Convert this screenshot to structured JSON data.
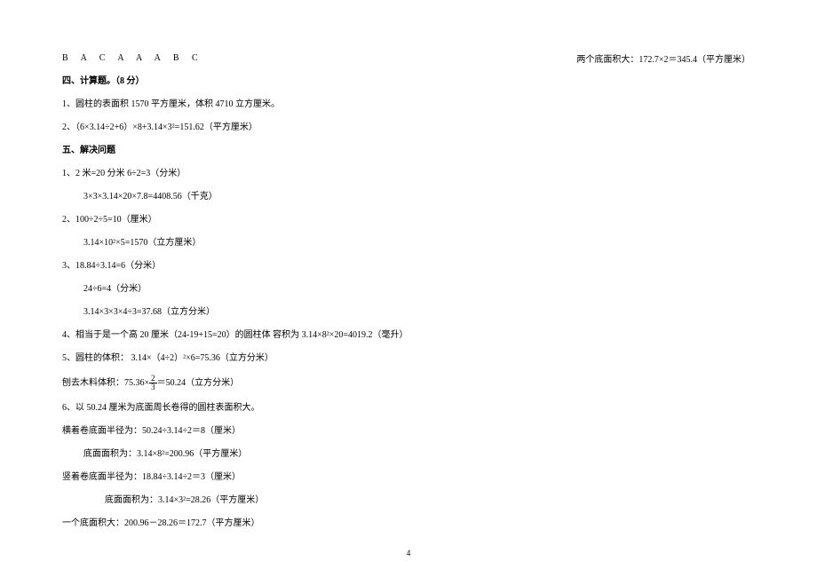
{
  "answer_letters": "B A C A A A B C",
  "right_note": "两个底面积大：172.7×2＝345.4（平方厘米）",
  "section4": {
    "heading": "四、计算题。（8 分）",
    "items": [
      "1、圆柱的表面积 1570 平方厘米，体积 4710 立方厘米。",
      "2、（6×3.14÷2+6）×8+3.14×3²=151.62（平方厘米）"
    ]
  },
  "section5": {
    "heading": "五、解决问题",
    "q1": {
      "line1": "1、2 米=20 分米   6÷2=3（分米）",
      "line2": "3×3×3.14×20×7.8=4408.56（千克）"
    },
    "q2": {
      "line1": "2、100÷2÷5=10（厘米）",
      "line2": "3.14×10²×5=1570（立方厘米）"
    },
    "q3": {
      "line1": "3、18.84÷3.14=6（分米）",
      "line2": "24÷6=4（分米）",
      "line3": "3.14×3×3×4÷3=37.68（立方分米）"
    },
    "q4": "4、相当于是一个高 20 厘米（24-19+15=20）的圆柱体  容积为 3.14×8²×20=4019.2（毫升）",
    "q5": "5、圆柱的体积： 3.14×（4÷2）²×6=75.36（立方分米）",
    "q5b_prefix": "刨去木料体积：75.36×",
    "q5b_num": "2",
    "q5b_den": "3",
    "q5b_suffix": "＝50.24（立方分米）",
    "q6": {
      "line1": "6、以 50.24 厘米为底面周长卷得的圆柱表面积大。",
      "line2": "横着卷底面半径为：50.24÷3.14÷2＝8（厘米）",
      "line3": "底面面积为：3.14×8²=200.96（平方厘米）",
      "line4": "竖着卷底面半径为：18.84÷3.14÷2＝3（厘米）",
      "line5": "底面面积为：3.14×3²=28.26（平方厘米）",
      "line6": "一个底面积大：200.96－28.26＝172.7（平方厘米）"
    }
  },
  "page_number": "4"
}
